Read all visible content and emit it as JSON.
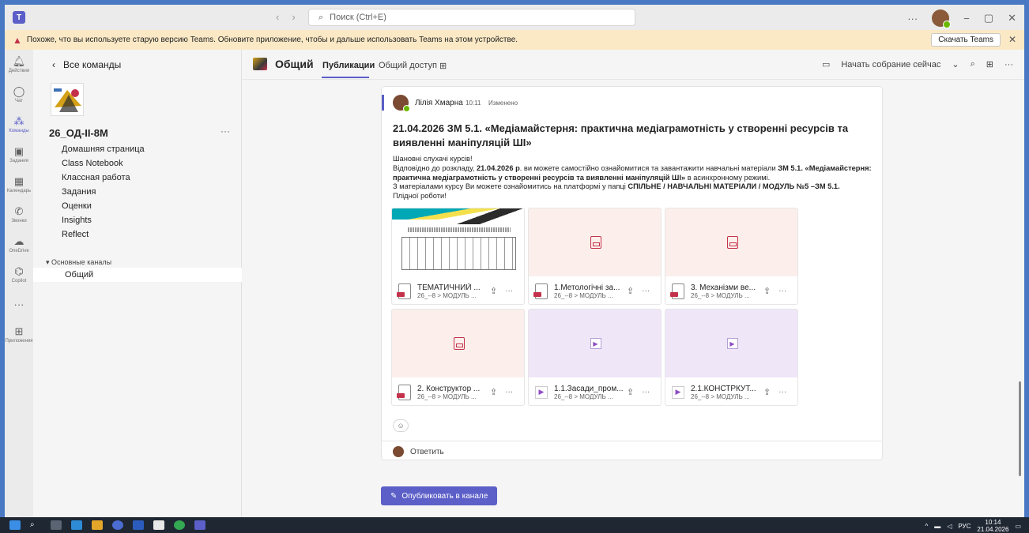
{
  "titlebar": {
    "search_placeholder": "Поиск (Ctrl+E)",
    "more": "···",
    "minimize": "−",
    "restore": "▢",
    "close": "✕"
  },
  "banner": {
    "text": "Похоже, что вы используете старую версию Teams. Обновите приложение, чтобы и дальше использовать Teams на этом устройстве.",
    "download_label": "Скачать Teams"
  },
  "rail": [
    {
      "label": "Действия",
      "icon": "bell-icon"
    },
    {
      "label": "Чат",
      "icon": "chat-icon"
    },
    {
      "label": "Команды",
      "icon": "teams-icon",
      "active": true
    },
    {
      "label": "Задания",
      "icon": "assignments-icon"
    },
    {
      "label": "Календарь",
      "icon": "calendar-icon"
    },
    {
      "label": "Звонки",
      "icon": "calls-icon"
    },
    {
      "label": "OneDrive",
      "icon": "onedrive-icon"
    },
    {
      "label": "Copilot",
      "icon": "copilot-icon"
    },
    {
      "label": "",
      "icon": "more-icon"
    },
    {
      "label": "Приложения",
      "icon": "apps-icon"
    }
  ],
  "team": {
    "back_label": "Все команды",
    "name": "26_ОД-ІІ-8М",
    "nav": [
      "Домашняя страница",
      "Class Notebook",
      "Классная работа",
      "Задания",
      "Оценки",
      "Insights",
      "Reflect"
    ],
    "channels_header": "Основные каналы",
    "channel": "Общий"
  },
  "channel": {
    "title": "Общий",
    "tabs": [
      "Публикации",
      "Общий доступ"
    ],
    "meet_label": "Начать собрание сейчас"
  },
  "post": {
    "author": "Лілія Хмарна",
    "time": "10:11",
    "edited": "Изменено",
    "title": "21.04.2026 ЗМ 5.1. «Медіамайстерня: практична медіаграмотність у створенні ресурсів та виявленні маніпуляцій ШІ»",
    "greeting": "Шановні слухачі курсів!",
    "p1_a": "Відповідно до розкладу, ",
    "p1_date": "21.04.2026 р",
    "p1_b": ". ви можете самостійно ознайомитися та завантажити навчальні матеріали ",
    "p1_zm": "ЗМ 5.1.",
    "p1_title": "«Медіамайстерня: практична медіаграмотність у створенні ресурсів та виявленні маніпуляцій ШІ»",
    "p1_c": " в асинхронному режимі.",
    "p2_a": "З матеріалами курсу Ви можете ознайомитись на платформі у папці ",
    "p2_path": "СПІЛЬНЕ / НАВЧАЛЬНІ МАТЕРІАЛИ / МОДУЛЬ №5 –ЗМ 5.1.",
    "p3": "Плідної роботи!",
    "attachments": [
      {
        "name": "ТЕМАТИЧНИЙ ...",
        "path": "26_--8 > МОДУЛЬ ...",
        "kind": "doc"
      },
      {
        "name": "1.Метологічні за...",
        "path": "26_--8 > МОДУЛЬ ...",
        "kind": "pdf"
      },
      {
        "name": "3. Механізми ве...",
        "path": "26_--8 > МОДУЛЬ ...",
        "kind": "pdf"
      },
      {
        "name": "2. Конструктор ...",
        "path": "26_--8 > МОДУЛЬ ...",
        "kind": "pdf"
      },
      {
        "name": "1.1.Засади_пром...",
        "path": "26_--8 > МОДУЛЬ ...",
        "kind": "video"
      },
      {
        "name": "2.1.КОНСТРКУТ...",
        "path": "26_--8 > МОДУЛЬ ...",
        "kind": "video"
      }
    ],
    "reply_label": "Ответить"
  },
  "publish_label": "Опубликовать в канале",
  "taskbar": {
    "lang": "РУС",
    "time": "10:14",
    "date": "21.04.2026"
  },
  "colors": {
    "accent": "#5b5fc7",
    "banner_bg": "#fbe9c6",
    "taskbar": "#1f2733"
  }
}
